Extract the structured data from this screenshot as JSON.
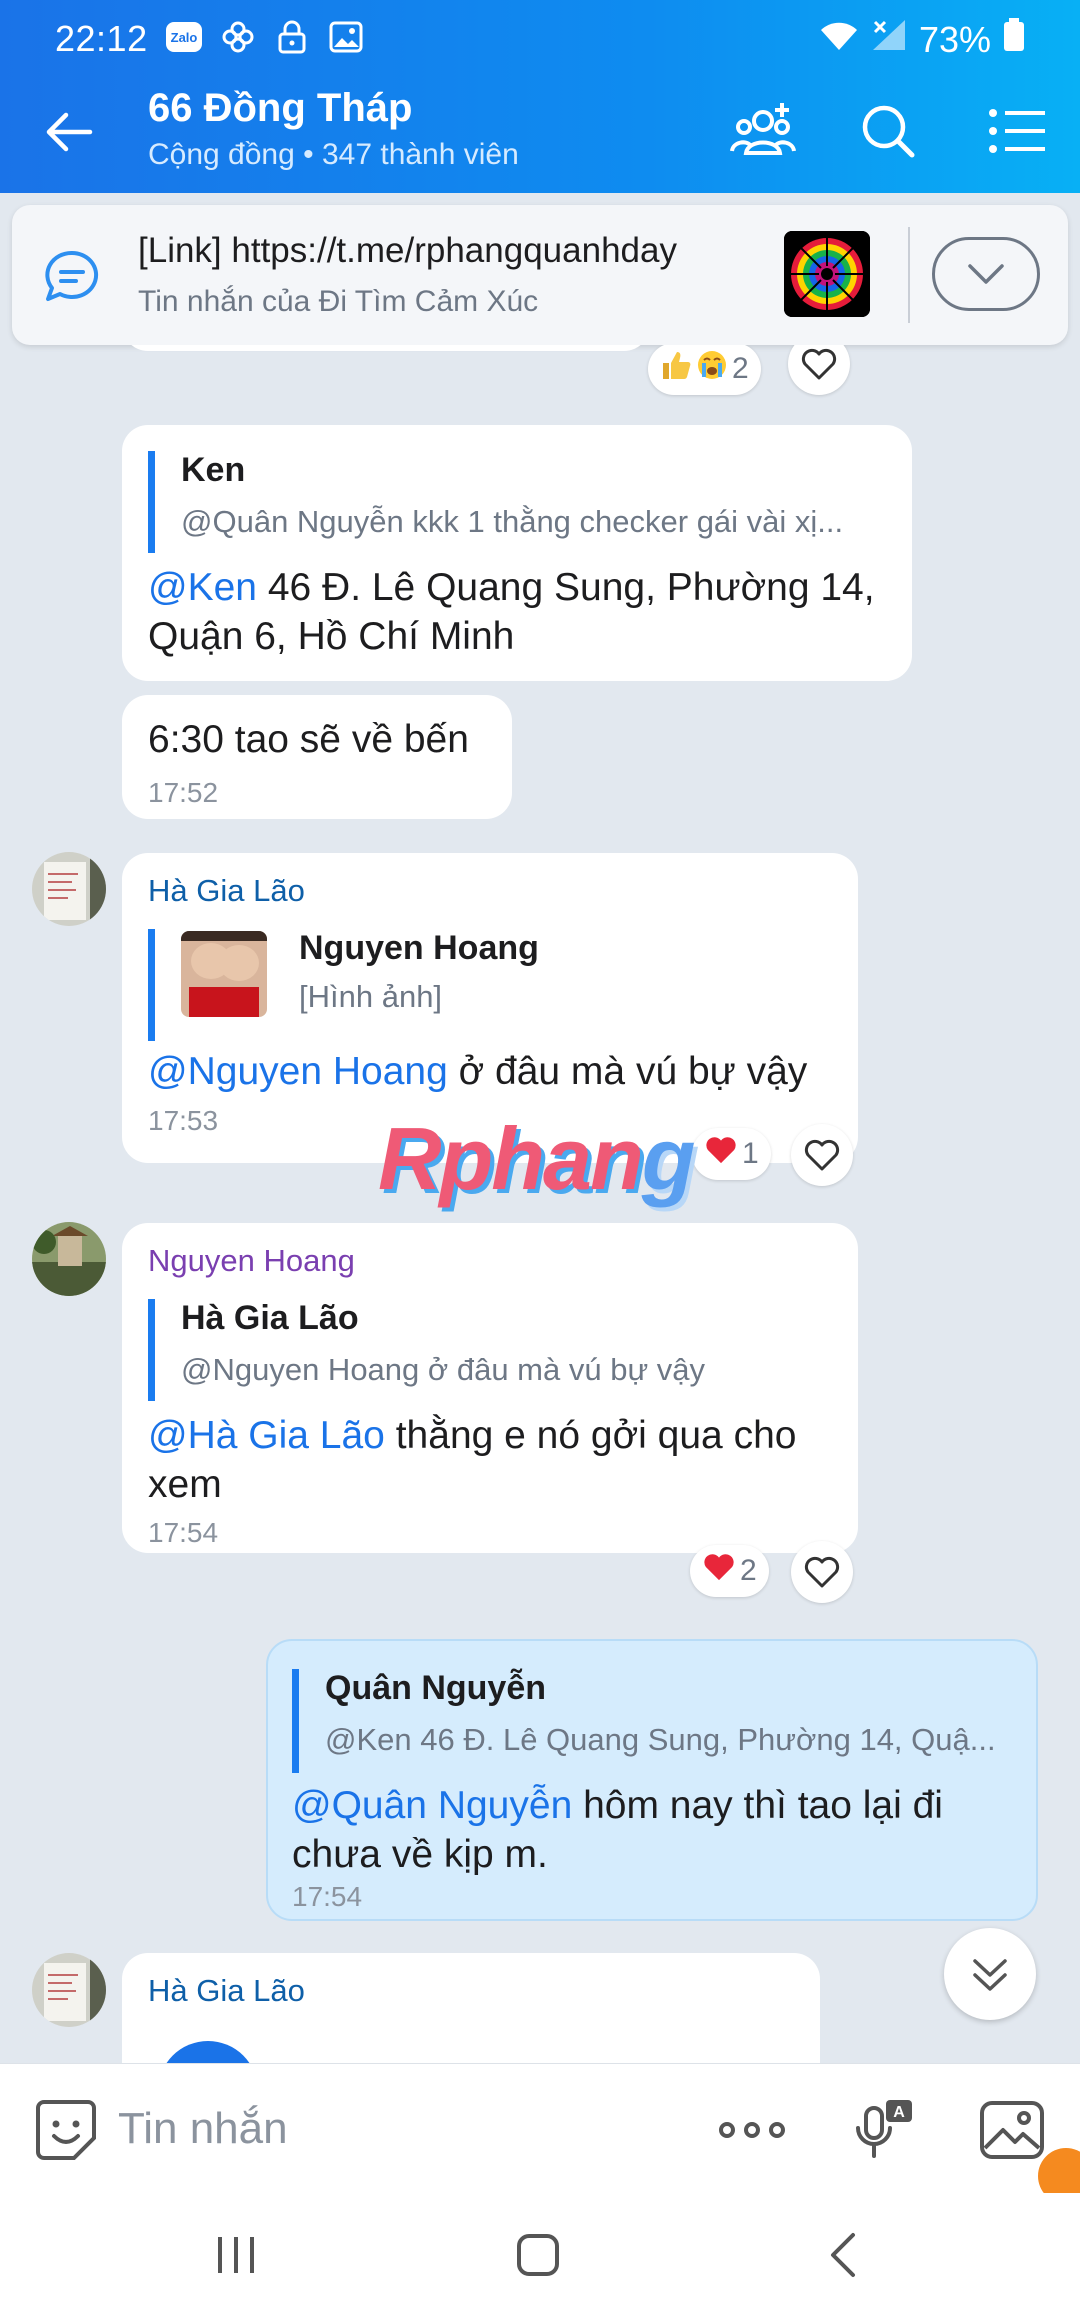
{
  "status_bar": {
    "time": "22:12",
    "zalo_badge": "Zalo",
    "battery": "73%"
  },
  "header": {
    "title": "66 Đồng Tháp",
    "subtitle": "Cộng đồng • 347 thành viên"
  },
  "pinned": {
    "text": "[Link] https://t.me/rphangquanhday",
    "source": "Tin nhắn của Đi Tìm Cảm Xúc"
  },
  "messages": [
    {
      "reaction_count": "2"
    },
    {
      "quote_name": "Ken",
      "quote_text": "@Quân Nguyễn kkk 1 thằng checker gái vài xị...",
      "mention": "@Ken",
      "text_line1": " 46 Đ. Lê Quang Sung, Phường 14,",
      "text_line2": "Quận 6, Hồ Chí Minh"
    },
    {
      "text": "6:30 tao sẽ về bến",
      "time": "17:52"
    },
    {
      "sender": "Hà Gia Lão",
      "quote_name": "Nguyen Hoang",
      "quote_text": "[Hình ảnh]",
      "mention": "@Nguyen Hoang",
      "text": " ở đâu mà vú bự vậy",
      "time": "17:53",
      "reaction_count": "1"
    },
    {
      "sender": "Nguyen Hoang",
      "quote_name": "Hà Gia Lão",
      "quote_text": "@Nguyen Hoang ở đâu mà vú bự vậy",
      "mention": "@Hà Gia Lão",
      "text_line1": " thằng e nó gởi qua cho",
      "text_line2": "xem",
      "time": "17:54",
      "reaction_count": "2"
    },
    {
      "quote_name": "Quân Nguyễn",
      "quote_text": "@Ken 46 Đ. Lê Quang Sung, Phường 14, Quậ...",
      "mention": "@Quân Nguyễn",
      "text_line1": " hôm nay thì tao lại đi",
      "text_line2": "chưa về kịp m.",
      "time": "17:54"
    },
    {
      "sender": "Hà Gia Lão"
    }
  ],
  "watermark": {
    "part1": "Rphan",
    "part2": "g"
  },
  "composer": {
    "placeholder": "Tin nhắn"
  },
  "colors": {
    "accent": "#1a73e8",
    "mine_bubble": "#d5ecfd",
    "heart": "#e8263a"
  },
  "icons": [
    "back-arrow-icon",
    "add-member-icon",
    "search-icon",
    "menu-list-icon",
    "chat-icon",
    "chevron-down-icon",
    "heart-icon",
    "sticker-icon",
    "more-icon",
    "voice-to-text-icon",
    "image-icon"
  ]
}
